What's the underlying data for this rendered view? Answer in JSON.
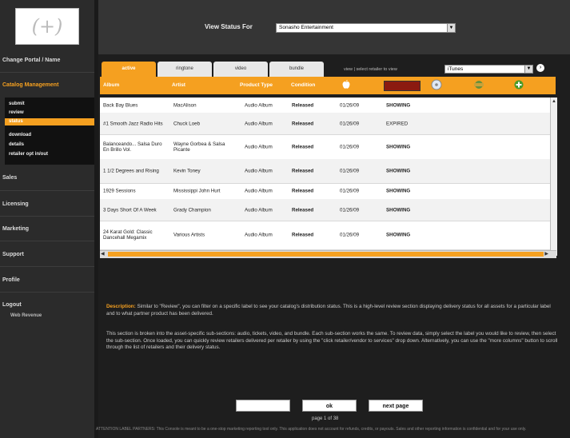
{
  "logo": {
    "text": "(+)"
  },
  "sidebar": {
    "items": [
      {
        "label": "Change Portal / Name",
        "active": false
      },
      {
        "label": "Catalog Management",
        "active": true
      },
      {
        "label": "Sales",
        "active": false
      },
      {
        "label": "Licensing",
        "active": false
      },
      {
        "label": "Marketing",
        "active": false
      },
      {
        "label": "Support",
        "active": false
      },
      {
        "label": "Profile",
        "active": false
      },
      {
        "label": "Logout",
        "active": false
      }
    ],
    "subitems": [
      "submit",
      "review",
      "status",
      "download",
      "details",
      "retailer opt in/out"
    ],
    "user": "Web Revenue"
  },
  "header": {
    "view_status_label": "View Status For",
    "view_status_value": "Sonasho Entertainment"
  },
  "tabs": [
    "active",
    "ringtone",
    "video",
    "bundle"
  ],
  "filter": {
    "label": "view | select retailer to view",
    "value": "iTunes"
  },
  "table": {
    "headers": [
      "Album",
      "Artist",
      "Product Type",
      "Condition"
    ],
    "rows": [
      {
        "album": "Back Bay Blues",
        "artist": "MacAlison",
        "type": "Audio Album",
        "condition": "Released",
        "date": "01/26/09",
        "status": "SHOWING"
      },
      {
        "album": "#1 Smooth Jazz Radio Hits",
        "artist": "Chuck Loeb",
        "type": "Audio Album",
        "condition": "Released",
        "date": "01/26/09",
        "status": "EXPIRED"
      },
      {
        "album": "Balanceando... Salsa Duro En Brillo Vol.",
        "artist": "Wayne Gorbea & Salsa Picante",
        "type": "Audio Album",
        "condition": "Released",
        "date": "01/26/09",
        "status": "SHOWING"
      },
      {
        "album": "1 1/2 Degrees and Rising",
        "artist": "Kevin Toney",
        "type": "Audio Album",
        "condition": "Released",
        "date": "01/26/09",
        "status": "SHOWING"
      },
      {
        "album": "1929 Sessions",
        "artist": "Mississippi John Hurt",
        "type": "Audio Album",
        "condition": "Released",
        "date": "01/26/09",
        "status": "SHOWING"
      },
      {
        "album": "3 Days Short Of A Week",
        "artist": "Grady Champion",
        "type": "Audio Album",
        "condition": "Released",
        "date": "01/26/09",
        "status": "SHOWING"
      },
      {
        "album": "24 Karat Gold: Classic Dancehall Megamix",
        "artist": "Various Artists",
        "type": "Audio Album",
        "condition": "Released",
        "date": "01/26/09",
        "status": "SHOWING"
      }
    ]
  },
  "description": {
    "label": "Description:",
    "p1": "Similar to \"Review\", you can filter on a specific label to see your catalog's distribution status. This is a high-level review section displaying delivery status for all assets for a particular label and to what partner product has been delivered.",
    "p2": "This section is broken into the asset-specific sub-sections: audio, tickets, video, and bundle. Each sub-section works the same. To review data, simply select the label you would like to review, then select the sub-section. Once loaded, you can quickly review retailers delivered per retailer by using the \"click retailer/vendor to services\" drop down. Alternatively, you can use the \"more columns\" button to scroll through the list of retailers and their delivery status."
  },
  "buttons": {
    "blank": "",
    "ok": "ok",
    "next": "next page"
  },
  "pagination": "page 1 of 38",
  "footer": "ATTENTION LABEL PARTNERS: This Console is meant to be a one-stop marketing reporting tool only. This application does not account for refunds, credits, or payouts. Sales and other reporting information is confidential and for your use only."
}
